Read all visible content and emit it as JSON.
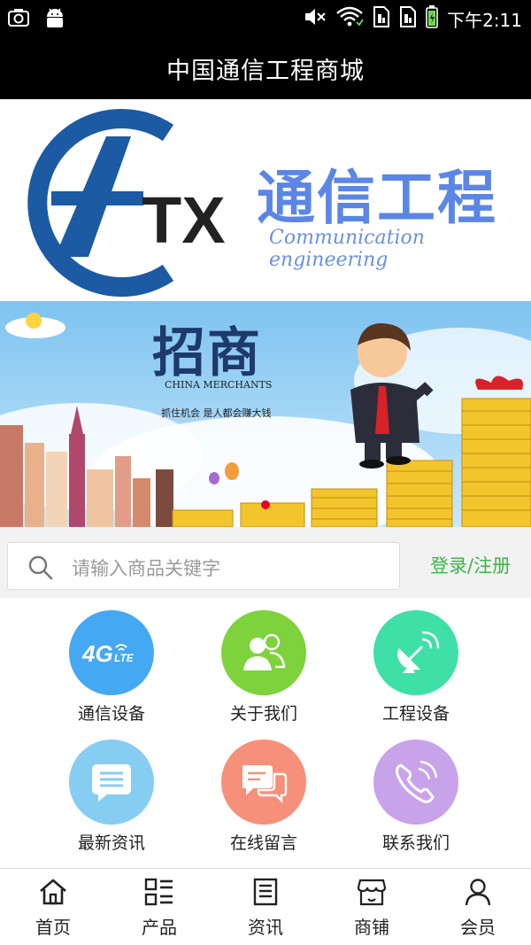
{
  "status_bar": {
    "time": "下午2:11",
    "icons": [
      "camera-icon",
      "android-icon",
      "mute-icon",
      "wifi-icon",
      "sim1-icon",
      "sim2-icon",
      "battery-icon"
    ]
  },
  "header": {
    "title": "中国通信工程商城"
  },
  "logo": {
    "mark": "TX",
    "cn_text": "通信工程",
    "en_text": "Communication engineering"
  },
  "banner": {
    "title": "招商",
    "en_title": "CHINA MERCHANTS",
    "slogan": "抓住机会 是人都会赚大钱",
    "carousel_active": 1
  },
  "search": {
    "placeholder": "请输入商品关键字",
    "login_label": "登录/注册"
  },
  "menu": {
    "items": [
      {
        "label": "通信设备",
        "icon": "4g-lte-icon",
        "color": "#45a8f2"
      },
      {
        "label": "关于我们",
        "icon": "users-icon",
        "color": "#7ed23c"
      },
      {
        "label": "工程设备",
        "icon": "satellite-dish-icon",
        "color": "#3fe0a8"
      },
      {
        "label": "最新资讯",
        "icon": "message-icon",
        "color": "#86cdf2"
      },
      {
        "label": "在线留言",
        "icon": "chat-bubbles-icon",
        "color": "#f6907a"
      },
      {
        "label": "联系我们",
        "icon": "phone-icon",
        "color": "#c9a3ea"
      }
    ]
  },
  "bottom_nav": {
    "items": [
      {
        "label": "首页",
        "icon": "home-icon"
      },
      {
        "label": "产品",
        "icon": "product-list-icon"
      },
      {
        "label": "资讯",
        "icon": "news-icon"
      },
      {
        "label": "商铺",
        "icon": "store-icon"
      },
      {
        "label": "会员",
        "icon": "member-icon"
      }
    ]
  },
  "colors": {
    "status_bg": "#000000",
    "accent_green": "#3fb44b",
    "logo_blue": "#1c5aa3",
    "logo_light_blue": "#5b86e5"
  }
}
